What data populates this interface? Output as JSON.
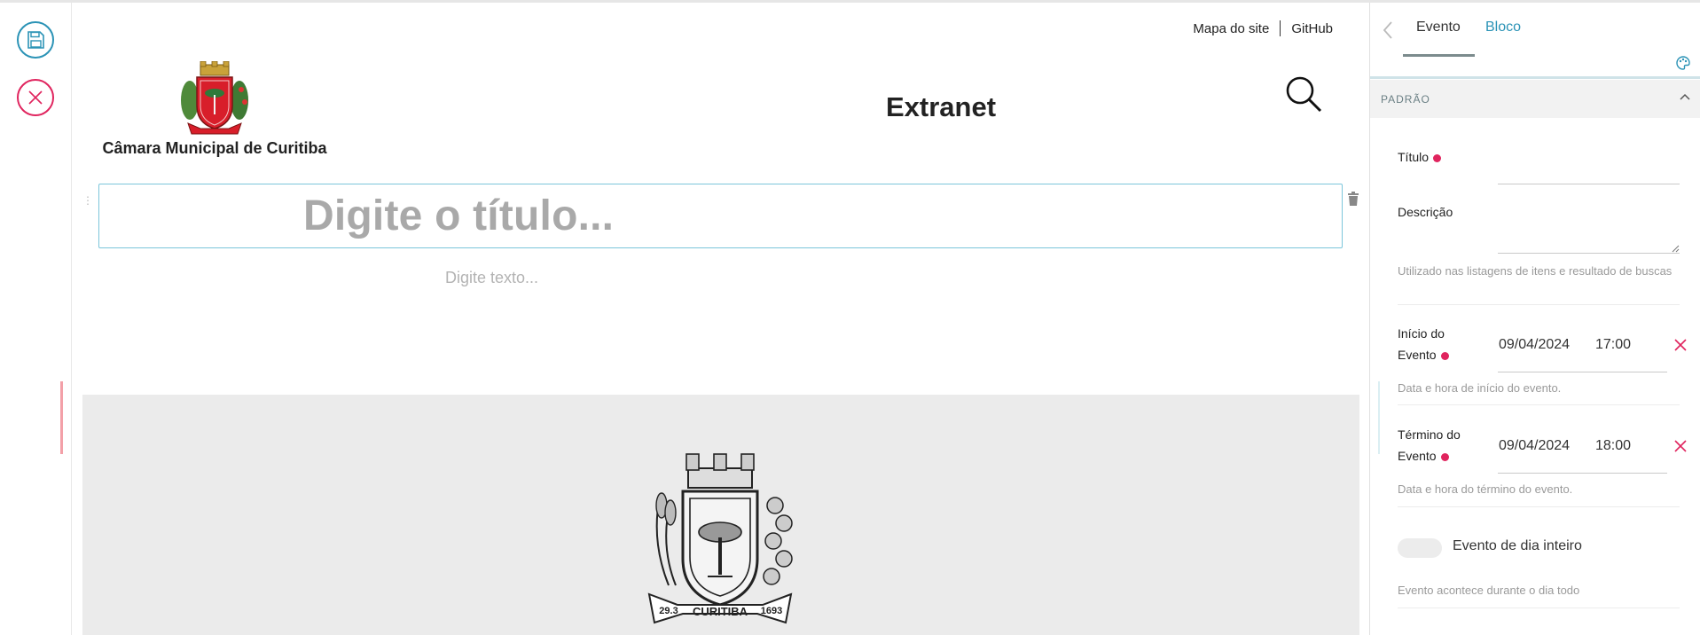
{
  "toolbar": {
    "save_icon": "floppy-disk-icon",
    "close_icon": "close-x-icon",
    "save_color": "#2b93b6",
    "close_color": "#e0245e"
  },
  "header": {
    "links": [
      "Mapa do site",
      "GitHub"
    ],
    "site_name": "Câmara Municipal de Curitiba",
    "section_title": "Extranet",
    "search_icon": "magnifier-icon"
  },
  "editor": {
    "title_placeholder": "Digite o título...",
    "text_placeholder": "Digite texto..."
  },
  "sidebar": {
    "tabs": [
      "Evento",
      "Bloco"
    ],
    "active_tab": "Evento",
    "section": "PADRÃO",
    "fields": {
      "titulo_label": "Título",
      "descricao_label": "Descrição",
      "descricao_help": "Utilizado nas listagens de itens e resultado de buscas",
      "inicio_label_1": "Início do",
      "inicio_label_2": "Evento",
      "inicio_date": "09/04/2024",
      "inicio_time": "17:00",
      "inicio_help": "Data e hora de início do evento.",
      "termino_label_1": "Término do",
      "termino_label_2": "Evento",
      "termino_date": "09/04/2024",
      "termino_time": "18:00",
      "termino_help": "Data e hora do término do evento.",
      "whole_day_label": "Evento de dia inteiro",
      "whole_day_help": "Evento acontece durante o dia todo",
      "whole_day_on": false
    },
    "accent_color": "#2b93b6",
    "required_color": "#e0245e"
  }
}
